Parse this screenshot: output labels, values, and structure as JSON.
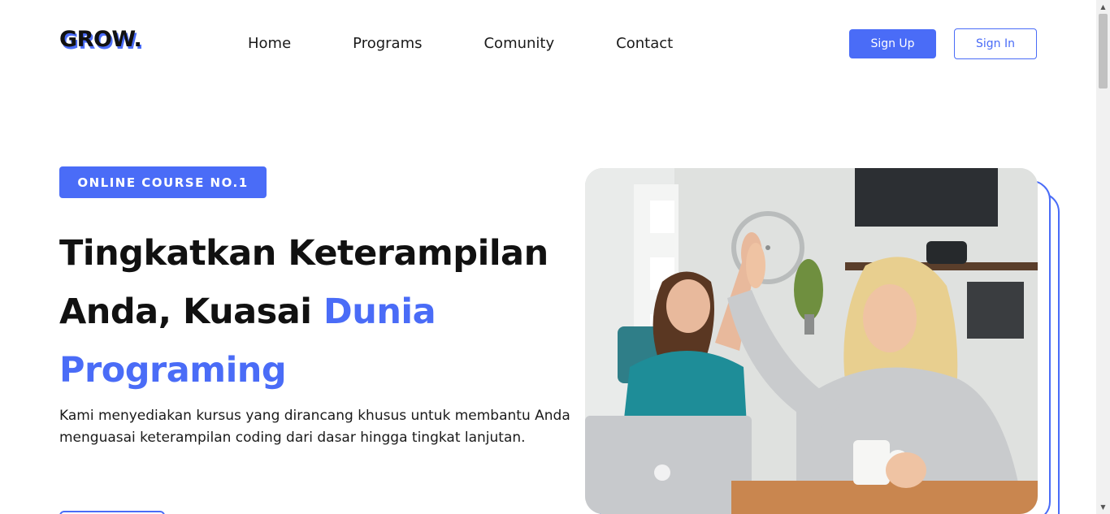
{
  "brand": {
    "logo": "GROW.",
    "accent": "#4a6cf7"
  },
  "nav": {
    "items": [
      {
        "label": "Home"
      },
      {
        "label": "Programs"
      },
      {
        "label": "Comunity"
      },
      {
        "label": "Contact"
      }
    ]
  },
  "auth": {
    "signup_label": "Sign Up",
    "signin_label": "Sign In"
  },
  "hero": {
    "badge": "ONLINE COURSE NO.1",
    "headline_line1": "Tingkatkan Keterampilan",
    "headline_line2_plain": "Anda, Kuasai ",
    "headline_line2_accent": "Dunia",
    "headline_line3_accent": "Programing",
    "description": "Kami menyediakan kursus yang dirancang khusus untuk membantu Anda menguasai keterampilan coding dari dasar hingga tingkat lanjutan.",
    "image_icon": "photo-two-women-high-five"
  }
}
